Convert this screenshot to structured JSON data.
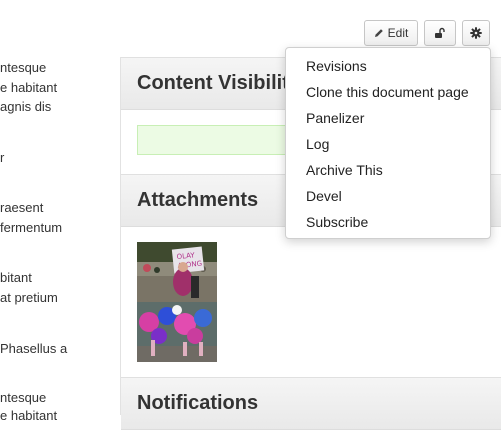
{
  "body_text_lines": [
    "ntesque",
    "e habitant",
    "agnis dis",
    "r",
    "raesent",
    "fermentum",
    "bitant",
    "at pretium",
    "Phasellus a",
    "ntesque",
    "e habitant"
  ],
  "toolbar": {
    "edit_label": "Edit",
    "edit_icon": "pencil-icon",
    "unlock_icon": "unlock-icon",
    "settings_icon": "gear-icon"
  },
  "sections": {
    "visibility_title": "Content Visibility",
    "attachments_title": "Attachments",
    "notifications_title": "Notifications"
  },
  "menu": {
    "items": [
      "Revisions",
      "Clone this document page",
      "Panelizer",
      "Log",
      "Archive This",
      "Devel",
      "Subscribe"
    ]
  },
  "colors": {
    "success_box_bg": "#ecfbe4",
    "success_box_border": "#c8efb5",
    "header_bg": "#eeeeee"
  }
}
